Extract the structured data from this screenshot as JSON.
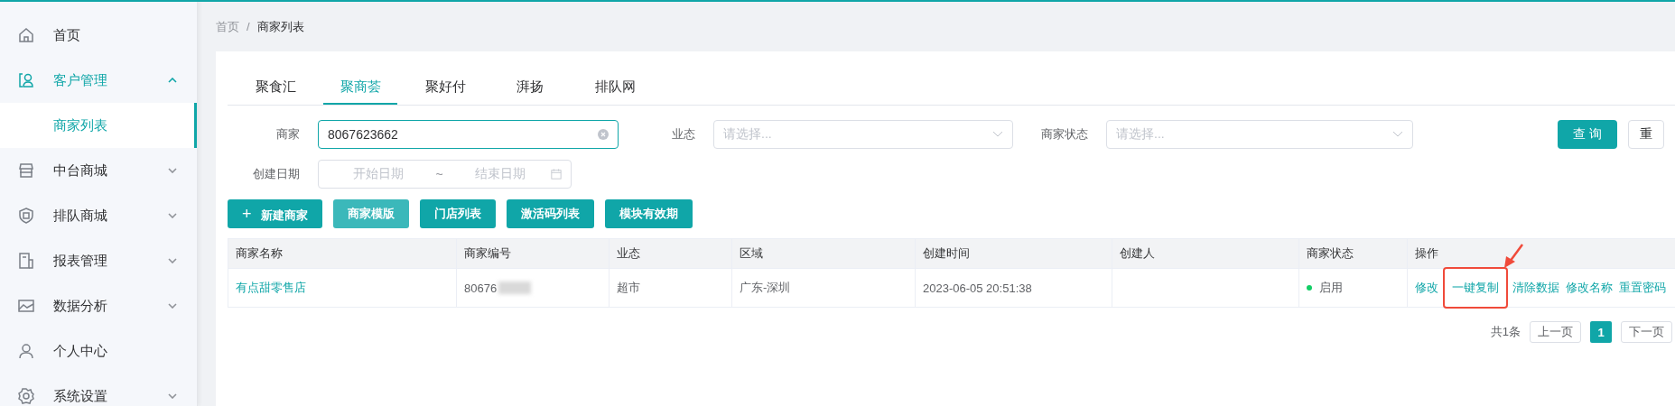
{
  "sidebar": {
    "items": [
      {
        "label": "首页",
        "selected": false
      },
      {
        "label": "客户管理",
        "selected": false,
        "expanded": true,
        "children": [
          {
            "label": "商家列表",
            "selected": true
          }
        ]
      },
      {
        "label": "中台商城",
        "selected": false,
        "expanded": false
      },
      {
        "label": "排队商城",
        "selected": false,
        "expanded": false
      },
      {
        "label": "报表管理",
        "selected": false,
        "expanded": false
      },
      {
        "label": "数据分析",
        "selected": false,
        "expanded": false
      },
      {
        "label": "个人中心",
        "selected": false
      },
      {
        "label": "系统设置",
        "selected": false,
        "expanded": false
      }
    ]
  },
  "breadcrumb": [
    "首页",
    "/",
    "商家列表"
  ],
  "tabs": [
    {
      "label": "聚食汇",
      "selected": false
    },
    {
      "label": "聚商荟",
      "selected": true
    },
    {
      "label": "聚好付",
      "selected": false
    },
    {
      "label": "湃扬",
      "selected": false
    },
    {
      "label": "排队网",
      "selected": false
    }
  ],
  "filters": {
    "merchant": {
      "label": "商家",
      "value": "8067623662"
    },
    "business": {
      "label": "业态",
      "placeholder": "请选择..."
    },
    "status": {
      "label": "商家状态",
      "placeholder": "请选择..."
    },
    "date": {
      "label": "创建日期",
      "start_placeholder": "开始日期",
      "separator": "~",
      "end_placeholder": "结束日期"
    },
    "query_button": "查 询",
    "reset_button": "重"
  },
  "actions": [
    {
      "label": "新建商家",
      "icon": "+",
      "hovered": false
    },
    {
      "label": "商家模版",
      "hovered": true
    },
    {
      "label": "门店列表",
      "hovered": false
    },
    {
      "label": "激活码列表",
      "hovered": false
    },
    {
      "label": "模块有效期",
      "hovered": false
    }
  ],
  "table": {
    "columns": [
      "商家名称",
      "商家编号",
      "业态",
      "区域",
      "创建时间",
      "创建人",
      "商家状态",
      "操作"
    ],
    "rows": [
      {
        "name": "有点甜零售店",
        "code": "80676",
        "code_redacted": true,
        "business": "超市",
        "region": "广东-深圳",
        "created": "2023-06-05 20:51:38",
        "status": "启用",
        "color": "#13ce66",
        "operations": [
          {
            "label": "修改",
            "highlighted": false
          },
          {
            "label": "一键复制",
            "highlighted": true
          },
          {
            "label": "清除数据",
            "highlighted": false
          },
          {
            "label": "修改名称",
            "highlighted": false
          },
          {
            "label": "重置密码",
            "highlighted": false
          }
        ]
      }
    ]
  },
  "pagination": {
    "total": "共1条",
    "prev": "上一页",
    "pages": [
      {
        "label": "1",
        "selected": true
      }
    ],
    "next": "下一页"
  }
}
